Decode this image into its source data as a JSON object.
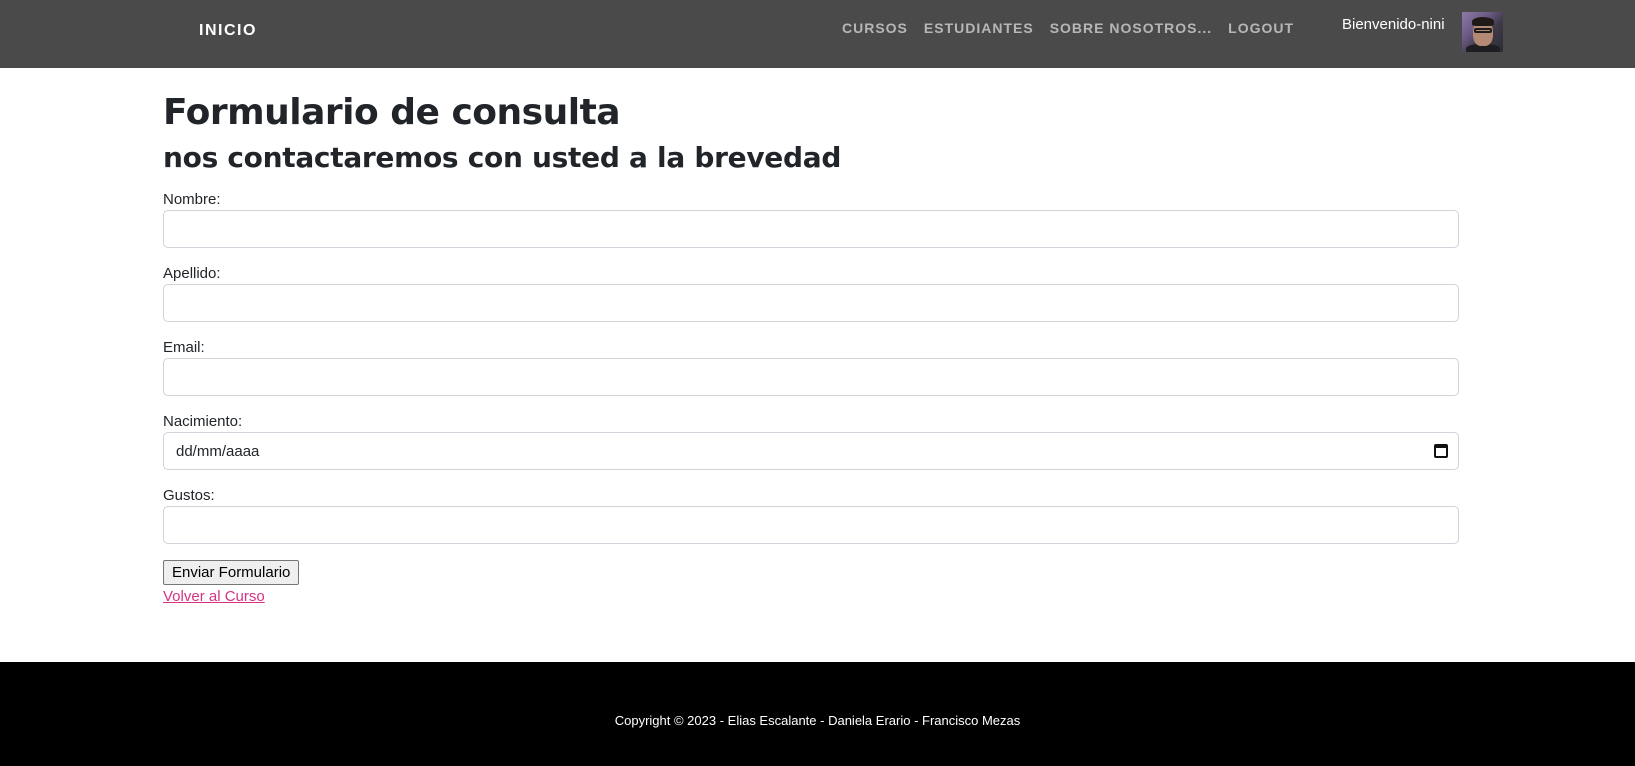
{
  "navbar": {
    "brand": "INICIO",
    "links": [
      "CURSOS",
      "ESTUDIANTES",
      "SOBRE NOSOTROS...",
      "LOGOUT"
    ],
    "welcome": "Bienvenido-nini",
    "avatar_icon": "user-avatar"
  },
  "page": {
    "title": "Formulario de consulta",
    "subtitle": "nos contactaremos con usted a la brevedad"
  },
  "form": {
    "fields": [
      {
        "label": "Nombre:",
        "value": ""
      },
      {
        "label": "Apellido:",
        "value": ""
      },
      {
        "label": "Email:",
        "value": ""
      },
      {
        "label": "Nacimiento:",
        "value": "dd/mm/aaaa"
      },
      {
        "label": "Gustos:",
        "value": ""
      }
    ],
    "submit_label": "Enviar Formulario",
    "back_link": "Volver al Curso"
  },
  "footer": {
    "text": "Copyright © 2023 - Elias Escalante - Daniela Erario - Francisco Mezas"
  },
  "colors": {
    "navbar_bg": "#4a4a4a",
    "footer_bg": "#000000",
    "link_color": "#d63384"
  }
}
